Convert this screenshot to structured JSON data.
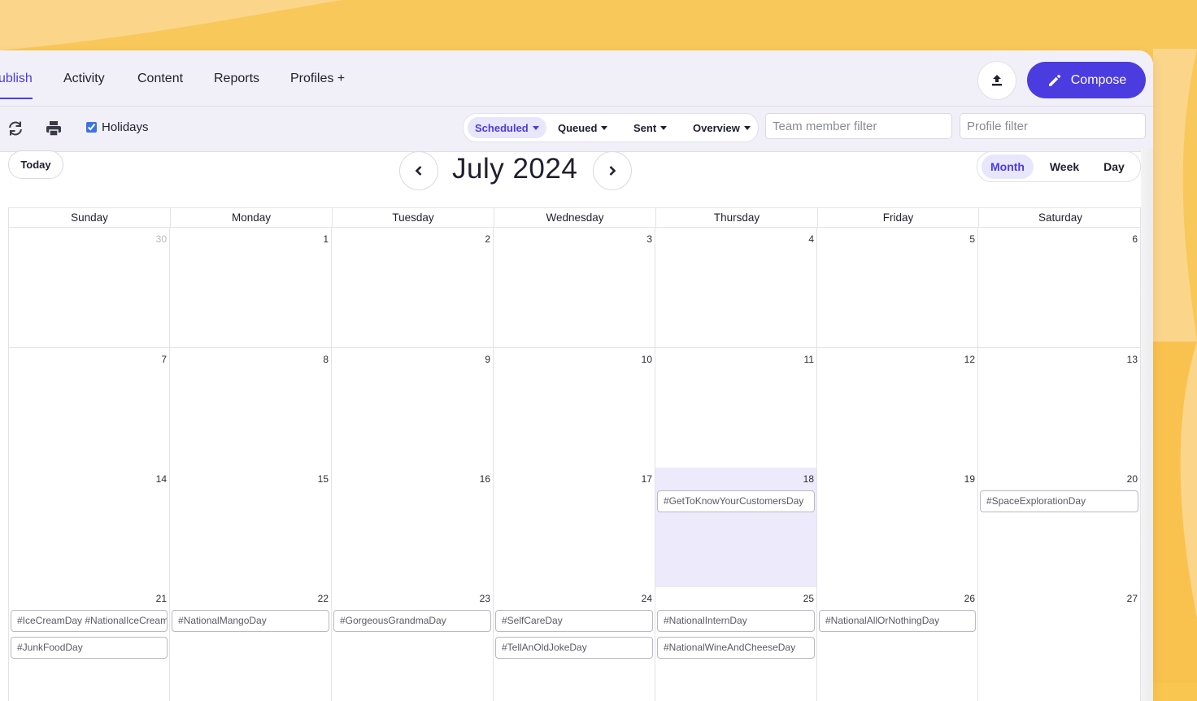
{
  "nav": {
    "tabs": [
      {
        "label": "ublish",
        "active": true
      },
      {
        "label": "Activity",
        "active": false
      },
      {
        "label": "Content",
        "active": false
      },
      {
        "label": "Reports",
        "active": false
      },
      {
        "label": "Profiles +",
        "active": false
      }
    ],
    "compose_label": "Compose"
  },
  "toolbar": {
    "holidays_label": "Holidays",
    "holidays_checked": true,
    "filters": [
      {
        "label": "Scheduled",
        "active": true
      },
      {
        "label": "Queued",
        "active": false
      },
      {
        "label": "Sent",
        "active": false
      },
      {
        "label": "Overview",
        "active": false
      }
    ],
    "team_filter_placeholder": "Team member filter",
    "profile_filter_placeholder": "Profile filter"
  },
  "calendar": {
    "today_label": "Today",
    "month_title": "July 2024",
    "views": [
      {
        "label": "Month",
        "active": true
      },
      {
        "label": "Week",
        "active": false
      },
      {
        "label": "Day",
        "active": false
      }
    ],
    "weekdays": [
      "Sunday",
      "Monday",
      "Tuesday",
      "Wednesday",
      "Thursday",
      "Friday",
      "Saturday"
    ],
    "weeks": [
      [
        {
          "day": "30",
          "other": true
        },
        {
          "day": "1"
        },
        {
          "day": "2"
        },
        {
          "day": "3"
        },
        {
          "day": "4"
        },
        {
          "day": "5"
        },
        {
          "day": "6"
        }
      ],
      [
        {
          "day": "7"
        },
        {
          "day": "8"
        },
        {
          "day": "9"
        },
        {
          "day": "10"
        },
        {
          "day": "11"
        },
        {
          "day": "12"
        },
        {
          "day": "13"
        }
      ],
      [
        {
          "day": "14"
        },
        {
          "day": "15"
        },
        {
          "day": "16"
        },
        {
          "day": "17"
        },
        {
          "day": "18",
          "today": true,
          "events": [
            "#GetToKnowYourCustomersDay"
          ]
        },
        {
          "day": "19"
        },
        {
          "day": "20",
          "events": [
            "#SpaceExplorationDay"
          ]
        }
      ],
      [
        {
          "day": "21",
          "events": [
            "#IceCreamDay #NationalIceCreamMonth",
            "#JunkFoodDay"
          ]
        },
        {
          "day": "22",
          "events": [
            "#NationalMangoDay"
          ]
        },
        {
          "day": "23",
          "events": [
            "#GorgeousGrandmaDay"
          ]
        },
        {
          "day": "24",
          "events": [
            "#SelfCareDay",
            "#TellAnOldJokeDay"
          ]
        },
        {
          "day": "25",
          "events": [
            "#NationalInternDay",
            "#NationalWineAndCheeseDay"
          ]
        },
        {
          "day": "26",
          "events": [
            "#NationalAllOrNothingDay"
          ]
        },
        {
          "day": "27"
        }
      ]
    ]
  },
  "colors": {
    "accent": "#4b3ce0",
    "today_bg": "#eceafb",
    "page_bg": "#f9c74f"
  }
}
